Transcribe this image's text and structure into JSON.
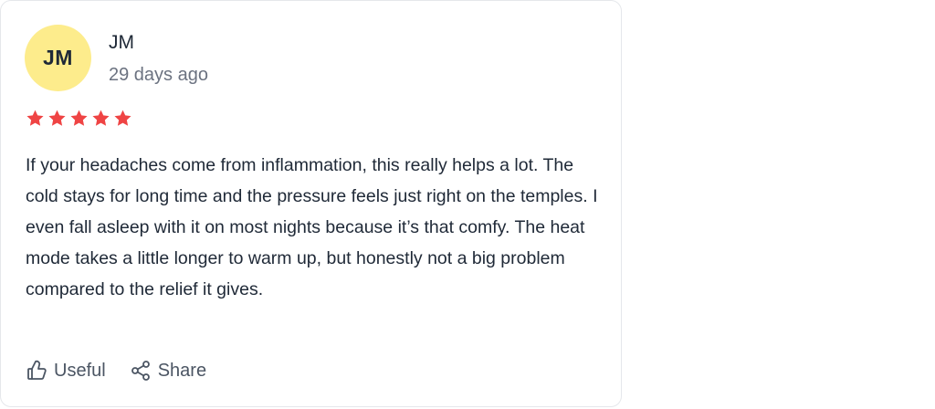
{
  "review": {
    "avatar_initials": "JM",
    "author": "JM",
    "timestamp": "29 days ago",
    "rating": 5,
    "rating_max": 5,
    "star_color": "#ef4444",
    "avatar_color": "#fdec8c",
    "text": "If your headaches come from inflammation, this really helps a lot. The cold stays for long time and the pressure feels just right on the temples. I even fall asleep with it on most nights because it’s that comfy. The heat mode takes a little longer to warm up, but honestly not a big problem compared to the relief it gives.",
    "actions": {
      "useful_label": "Useful",
      "useful_icon": "thumbs-up-icon",
      "share_label": "Share",
      "share_icon": "share-icon"
    }
  }
}
